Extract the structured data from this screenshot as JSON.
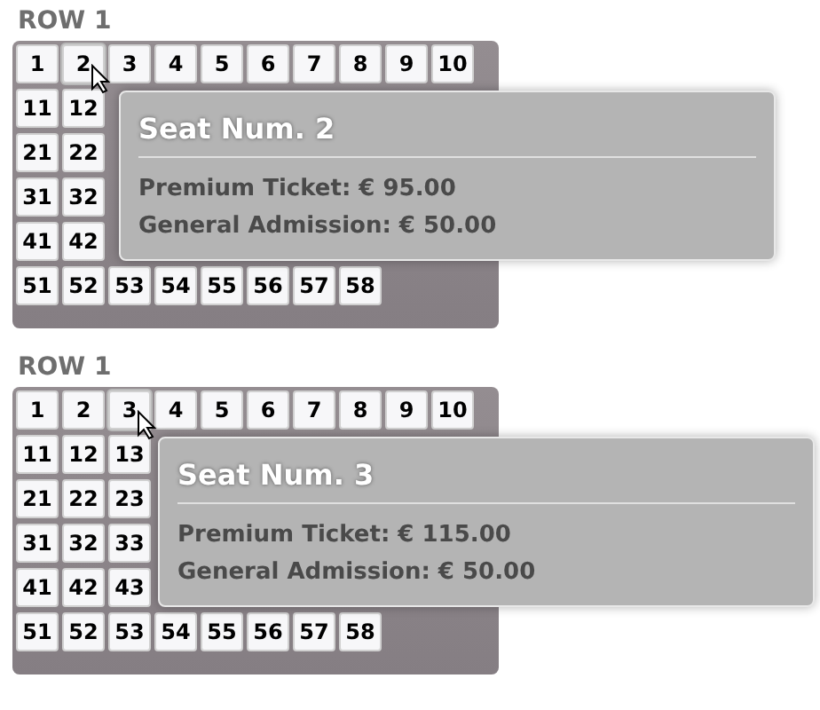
{
  "seat_maps": [
    {
      "row_label": "ROW 1",
      "rows": [
        [
          {
            "label": "1",
            "hovered": false
          },
          {
            "label": "2",
            "hovered": true
          },
          {
            "label": "3",
            "hovered": false
          },
          {
            "label": "4",
            "hovered": false
          },
          {
            "label": "5",
            "hovered": false
          },
          {
            "label": "6",
            "hovered": false
          },
          {
            "label": "7",
            "hovered": false
          },
          {
            "label": "8",
            "hovered": false
          },
          {
            "label": "9",
            "hovered": false
          },
          {
            "label": "10",
            "hovered": false
          }
        ],
        [
          {
            "label": "11",
            "hovered": false
          },
          {
            "label": "12",
            "hovered": false
          }
        ],
        [
          {
            "label": "21",
            "hovered": false
          },
          {
            "label": "22",
            "hovered": false
          }
        ],
        [
          {
            "label": "31",
            "hovered": false
          },
          {
            "label": "32",
            "hovered": false
          }
        ],
        [
          {
            "label": "41",
            "hovered": false
          },
          {
            "label": "42",
            "hovered": false
          }
        ],
        [
          {
            "label": "51",
            "hovered": false
          },
          {
            "label": "52",
            "hovered": false
          },
          {
            "label": "53",
            "hovered": false
          },
          {
            "label": "54",
            "hovered": false
          },
          {
            "label": "55",
            "hovered": false
          },
          {
            "label": "56",
            "hovered": false
          },
          {
            "label": "57",
            "hovered": false
          },
          {
            "label": "58",
            "hovered": false
          }
        ]
      ],
      "tooltip": {
        "title": "Seat Num. 2",
        "lines": [
          "Premium Ticket: € 95.00",
          "General Admission: € 50.00"
        ]
      }
    },
    {
      "row_label": "ROW 1",
      "rows": [
        [
          {
            "label": "1",
            "hovered": false
          },
          {
            "label": "2",
            "hovered": false
          },
          {
            "label": "3",
            "hovered": true
          },
          {
            "label": "4",
            "hovered": false
          },
          {
            "label": "5",
            "hovered": false
          },
          {
            "label": "6",
            "hovered": false
          },
          {
            "label": "7",
            "hovered": false
          },
          {
            "label": "8",
            "hovered": false
          },
          {
            "label": "9",
            "hovered": false
          },
          {
            "label": "10",
            "hovered": false
          }
        ],
        [
          {
            "label": "11",
            "hovered": false
          },
          {
            "label": "12",
            "hovered": false
          },
          {
            "label": "13",
            "hovered": false
          }
        ],
        [
          {
            "label": "21",
            "hovered": false
          },
          {
            "label": "22",
            "hovered": false
          },
          {
            "label": "23",
            "hovered": false
          }
        ],
        [
          {
            "label": "31",
            "hovered": false
          },
          {
            "label": "32",
            "hovered": false
          },
          {
            "label": "33",
            "hovered": false
          }
        ],
        [
          {
            "label": "41",
            "hovered": false
          },
          {
            "label": "42",
            "hovered": false
          },
          {
            "label": "43",
            "hovered": false
          }
        ],
        [
          {
            "label": "51",
            "hovered": false
          },
          {
            "label": "52",
            "hovered": false
          },
          {
            "label": "53",
            "hovered": false
          },
          {
            "label": "54",
            "hovered": false
          },
          {
            "label": "55",
            "hovered": false
          },
          {
            "label": "56",
            "hovered": false
          },
          {
            "label": "57",
            "hovered": false
          },
          {
            "label": "58",
            "hovered": false
          }
        ]
      ],
      "tooltip": {
        "title": "Seat Num. 3",
        "lines": [
          "Premium Ticket: € 115.00",
          "General Admission: € 50.00"
        ]
      }
    }
  ]
}
